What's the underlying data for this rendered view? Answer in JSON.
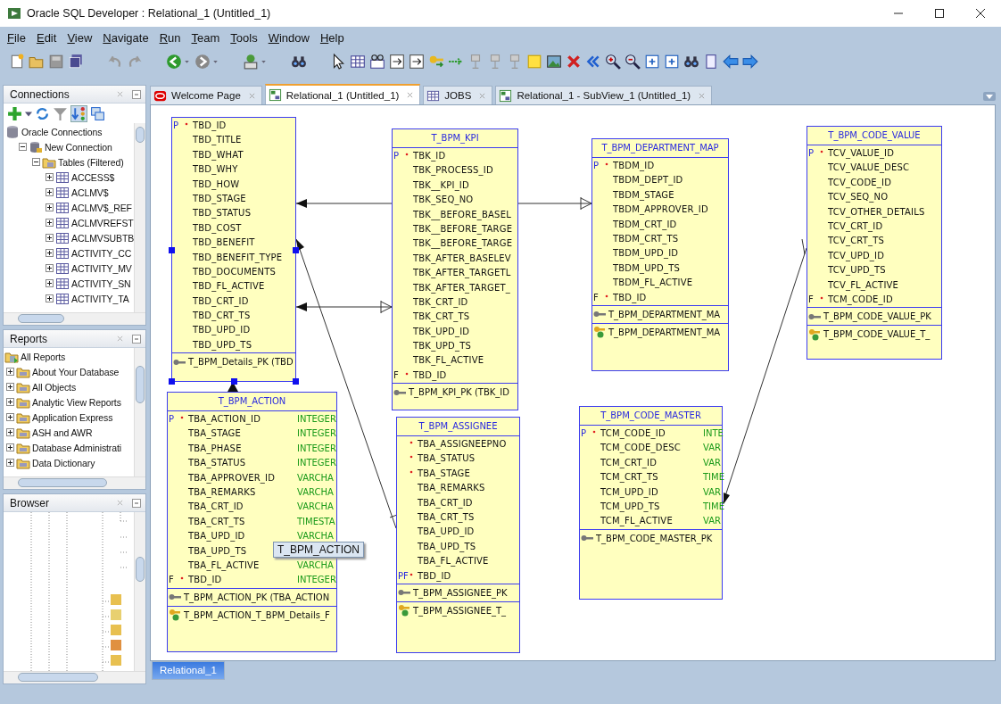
{
  "window": {
    "title": "Oracle SQL Developer : Relational_1 (Untitled_1)"
  },
  "menu": [
    "File",
    "Edit",
    "View",
    "Navigate",
    "Run",
    "Team",
    "Tools",
    "Window",
    "Help"
  ],
  "connections": {
    "title": "Connections",
    "items": [
      {
        "label": "Oracle Connections",
        "kind": "database",
        "children": [
          {
            "label": "New Connection",
            "kind": "connection",
            "expanded": true,
            "children": [
              {
                "label": "Tables (Filtered)",
                "kind": "folder",
                "expanded": true,
                "children": [
                  {
                    "label": "ACCESS$",
                    "kind": "table",
                    "expanded": false
                  },
                  {
                    "label": "ACLMV$",
                    "kind": "table",
                    "expanded": false
                  },
                  {
                    "label": "ACLMV$_REF",
                    "kind": "table",
                    "expanded": false
                  },
                  {
                    "label": "ACLMVREFST",
                    "kind": "table",
                    "expanded": false
                  },
                  {
                    "label": "ACLMVSUBTB",
                    "kind": "table",
                    "expanded": false
                  },
                  {
                    "label": "ACTIVITY_CC",
                    "kind": "table",
                    "expanded": false
                  },
                  {
                    "label": "ACTIVITY_MV",
                    "kind": "table",
                    "expanded": false
                  },
                  {
                    "label": "ACTIVITY_SN",
                    "kind": "table",
                    "expanded": false
                  },
                  {
                    "label": "ACTIVITY_TA",
                    "kind": "table",
                    "expanded": false
                  }
                ]
              }
            ]
          }
        ]
      }
    ]
  },
  "reports": {
    "title": "Reports",
    "items": [
      {
        "label": "All Reports",
        "kind": "reports",
        "children": [
          {
            "label": "About Your Database",
            "kind": "folder",
            "expanded": false
          },
          {
            "label": "All Objects",
            "kind": "folder",
            "expanded": false
          },
          {
            "label": "Analytic View Reports",
            "kind": "folder",
            "expanded": false
          },
          {
            "label": "Application Express",
            "kind": "folder",
            "expanded": false
          },
          {
            "label": "ASH and AWR",
            "kind": "folder",
            "expanded": false
          },
          {
            "label": "Database Administrati",
            "kind": "folder",
            "expanded": false
          },
          {
            "label": "Data Dictionary",
            "kind": "folder",
            "expanded": false
          }
        ]
      }
    ]
  },
  "browser": {
    "title": "Browser"
  },
  "tabs": [
    {
      "label": "Welcome Page",
      "kind": "welcome",
      "selected": false
    },
    {
      "label": "Relational_1 (Untitled_1)",
      "kind": "diagram",
      "selected": true
    },
    {
      "label": "JOBS",
      "kind": "table",
      "selected": false
    },
    {
      "label": "Relational_1 - SubView_1 (Untitled_1)",
      "kind": "diagram",
      "selected": false
    }
  ],
  "entities": [
    {
      "selected": true,
      "columns": [
        {
          "flag": "P",
          "required": true,
          "name": "TBD_ID"
        },
        {
          "name": "TBD_TITLE"
        },
        {
          "name": "TBD_WHAT"
        },
        {
          "name": "TBD_WHY"
        },
        {
          "name": "TBD_HOW"
        },
        {
          "name": "TBD_STAGE"
        },
        {
          "name": "TBD_STATUS"
        },
        {
          "name": "TBD_COST"
        },
        {
          "name": "TBD_BENEFIT"
        },
        {
          "name": "TBD_BENEFIT_TYPE"
        },
        {
          "name": "TBD_DOCUMENTS"
        },
        {
          "name": "TBD_FL_ACTIVE"
        },
        {
          "name": "TBD_CRT_ID"
        },
        {
          "name": "TBD_CRT_TS"
        },
        {
          "name": "TBD_UPD_ID"
        },
        {
          "name": "TBD_UPD_TS"
        }
      ],
      "keys": [
        {
          "kind": "pk",
          "text": "T_BPM_Details_PK (TBD"
        }
      ]
    },
    {
      "selected": false,
      "title": "T_BPM_KPI",
      "columns": [
        {
          "flag": "P",
          "required": true,
          "name": "TBK_ID"
        },
        {
          "name": "TBK_PROCESS_ID"
        },
        {
          "name": "TBK__KPI_ID"
        },
        {
          "name": "TBK_SEQ_NO"
        },
        {
          "name": "TBK__BEFORE_BASEL"
        },
        {
          "name": "TBK__BEFORE_TARGE"
        },
        {
          "name": "TBK__BEFORE_TARGE"
        },
        {
          "name": "TBK_AFTER_BASELEV"
        },
        {
          "name": "TBK_AFTER_TARGETL"
        },
        {
          "name": "TBK_AFTER_TARGET_"
        },
        {
          "name": "TBK_CRT_ID"
        },
        {
          "name": "TBK_CRT_TS"
        },
        {
          "name": "TBK_UPD_ID"
        },
        {
          "name": "TBK_UPD_TS"
        },
        {
          "name": "TBK_FL_ACTIVE"
        },
        {
          "flag": "F",
          "required": true,
          "name": "TBD_ID"
        }
      ],
      "keys": [
        {
          "kind": "pk",
          "text": "T_BPM_KPI_PK (TBK_ID"
        }
      ]
    },
    {
      "selected": false,
      "title": "T_BPM_DEPARTMENT_MAP",
      "columns": [
        {
          "flag": "P",
          "required": true,
          "name": "TBDM_ID"
        },
        {
          "name": "TBDM_DEPT_ID"
        },
        {
          "name": "TBDM_STAGE"
        },
        {
          "name": "TBDM_APPROVER_ID"
        },
        {
          "name": "TBDM_CRT_ID"
        },
        {
          "name": "TBDM_CRT_TS"
        },
        {
          "name": "TBDM_UPD_ID"
        },
        {
          "name": "TBDM_UPD_TS"
        },
        {
          "name": "TBDM_FL_ACTIVE"
        },
        {
          "flag": "F",
          "required": true,
          "name": "TBD_ID"
        }
      ],
      "keys": [
        {
          "kind": "pk",
          "text": "T_BPM_DEPARTMENT_MA"
        },
        {
          "kind": "fk",
          "text": "T_BPM_DEPARTMENT_MA"
        }
      ]
    },
    {
      "selected": false,
      "title": "T_BPM_CODE_VALUE",
      "columns": [
        {
          "flag": "P",
          "required": true,
          "name": "TCV_VALUE_ID"
        },
        {
          "name": "TCV_VALUE_DESC"
        },
        {
          "name": "TCV_CODE_ID"
        },
        {
          "name": "TCV_SEQ_NO"
        },
        {
          "name": "TCV_OTHER_DETAILS"
        },
        {
          "name": "TCV_CRT_ID"
        },
        {
          "name": "TCV_CRT_TS"
        },
        {
          "name": "TCV_UPD_ID"
        },
        {
          "name": "TCV_UPD_TS"
        },
        {
          "name": "TCV_FL_ACTIVE"
        },
        {
          "flag": "F",
          "required": true,
          "name": "TCM_CODE_ID"
        }
      ],
      "keys": [
        {
          "kind": "pk",
          "text": "T_BPM_CODE_VALUE_PK"
        },
        {
          "kind": "fk",
          "text": "T_BPM_CODE_VALUE_T_"
        }
      ]
    },
    {
      "selected": false,
      "title": "T_BPM_ACTION",
      "columns": [
        {
          "flag": "P",
          "required": true,
          "name": "TBA_ACTION_ID",
          "type": "INTEGER"
        },
        {
          "name": "TBA_STAGE",
          "type": "INTEGER"
        },
        {
          "name": "TBA_PHASE",
          "type": "INTEGER"
        },
        {
          "name": "TBA_STATUS",
          "type": "INTEGER"
        },
        {
          "name": "TBA_APPROVER_ID",
          "type": "VARCHA"
        },
        {
          "name": "TBA_REMARKS",
          "type": "VARCHA"
        },
        {
          "name": "TBA_CRT_ID",
          "type": "VARCHA"
        },
        {
          "name": "TBA_CRT_TS",
          "type": "TIMESTA"
        },
        {
          "name": "TBA_UPD_ID",
          "type": "VARCHA"
        },
        {
          "name": "TBA_UPD_TS"
        },
        {
          "name": "TBA_FL_ACTIVE",
          "type": "VARCHA"
        },
        {
          "flag": "F",
          "required": true,
          "name": "TBD_ID",
          "type": "INTEGER"
        }
      ],
      "keys": [
        {
          "kind": "pk",
          "text": "T_BPM_ACTION_PK (TBA_ACTION"
        },
        {
          "kind": "fk",
          "text": "T_BPM_ACTION_T_BPM_Details_F"
        }
      ]
    },
    {
      "selected": false,
      "title": "T_BPM_ASSIGNEE",
      "columns": [
        {
          "required": true,
          "name": "TBA_ASSIGNEEPNO"
        },
        {
          "required": true,
          "name": "TBA_STATUS"
        },
        {
          "required": true,
          "name": "TBA_STAGE"
        },
        {
          "name": "TBA_REMARKS"
        },
        {
          "name": "TBA_CRT_ID"
        },
        {
          "name": "TBA_CRT_TS"
        },
        {
          "name": "TBA_UPD_ID"
        },
        {
          "name": "TBA_UPD_TS"
        },
        {
          "name": "TBA_FL_ACTIVE"
        },
        {
          "flag": "PF",
          "required": true,
          "name": "TBD_ID"
        }
      ],
      "keys": [
        {
          "kind": "pk",
          "text": "T_BPM_ASSIGNEE_PK"
        },
        {
          "kind": "fk",
          "text": "T_BPM_ASSIGNEE_T_"
        }
      ]
    },
    {
      "selected": false,
      "title": "T_BPM_CODE_MASTER",
      "columns": [
        {
          "flag": "P",
          "required": true,
          "name": "TCM_CODE_ID",
          "type": "INTE"
        },
        {
          "name": "TCM_CODE_DESC",
          "type": "VAR"
        },
        {
          "name": "TCM_CRT_ID",
          "type": "VAR"
        },
        {
          "name": "TCM_CRT_TS",
          "type": "TIME"
        },
        {
          "name": "TCM_UPD_ID",
          "type": "VAR"
        },
        {
          "name": "TCM_UPD_TS",
          "type": "TIME"
        },
        {
          "name": "TCM_FL_ACTIVE",
          "type": "VAR"
        }
      ],
      "keys": [
        {
          "kind": "pk",
          "text": "T_BPM_CODE_MASTER_PK"
        }
      ]
    }
  ],
  "tooltip": "T_BPM_ACTION",
  "bottom_tabs": [
    {
      "label": "Relational_1",
      "selected": true
    }
  ]
}
